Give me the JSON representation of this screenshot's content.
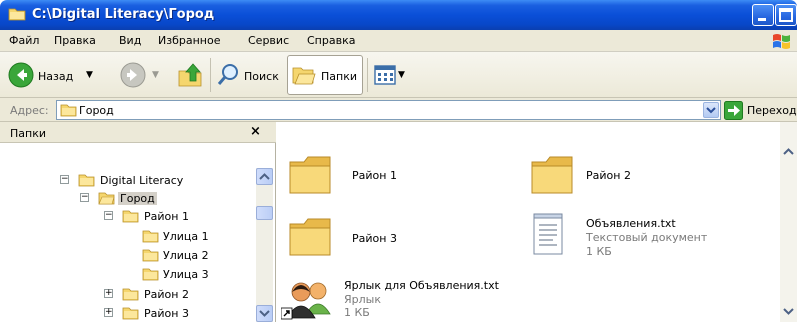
{
  "window": {
    "title": "C:\\Digital Literacy\\Город",
    "title_icon": "folder-icon"
  },
  "menu": {
    "items": [
      "Файл",
      "Правка",
      "Вид",
      "Избранное",
      "Сервис",
      "Справка"
    ]
  },
  "toolbar": {
    "back_label": "Назад",
    "search_label": "Поиск",
    "folders_label": "Папки"
  },
  "address": {
    "label": "Адрес:",
    "value": "Город",
    "go_label": "Переход"
  },
  "folders_pane": {
    "title": "Папки",
    "close_glyph": "×",
    "tree": [
      {
        "label": "Digital Literacy",
        "expander": "−"
      },
      {
        "label": "Город",
        "expander": "−",
        "selected": true
      },
      {
        "label": "Район 1",
        "expander": "−"
      },
      {
        "label": "Улица 1"
      },
      {
        "label": "Улица 2"
      },
      {
        "label": "Улица 3"
      },
      {
        "label": "Район 2",
        "expander": "+"
      },
      {
        "label": "Район 3",
        "expander": "+"
      }
    ]
  },
  "content": {
    "items": [
      {
        "name": "Район 1",
        "type": "folder"
      },
      {
        "name": "Район 2",
        "type": "folder"
      },
      {
        "name": "Район 3",
        "type": "folder"
      },
      {
        "name": "Объявления.txt",
        "type": "text",
        "sub1": "Текстовый документ",
        "sub2": "1 КБ"
      },
      {
        "name": "Ярлык для Объявления.txt",
        "type": "shortcut",
        "sub1": "Ярлык",
        "sub2": "1 КБ"
      }
    ]
  },
  "colors": {
    "title_bar": "#0a4fd8",
    "folder_yellow": "#f6d16a",
    "chrome": "#ece9d8"
  }
}
